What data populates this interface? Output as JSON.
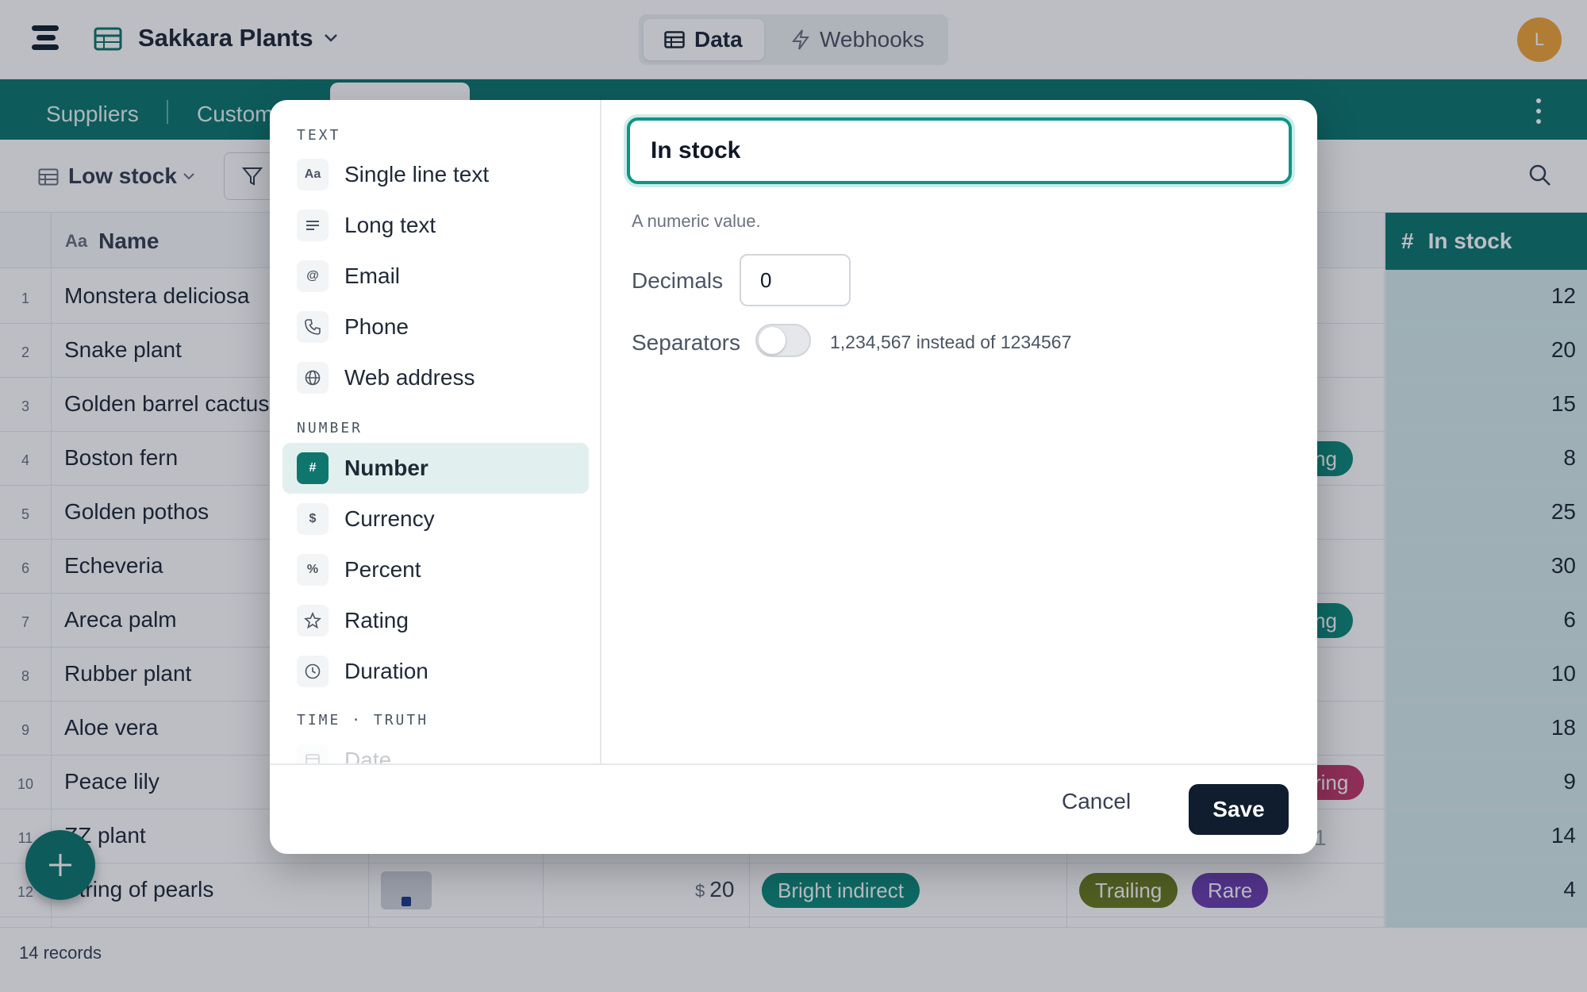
{
  "app": {
    "base_title": "Sakkara Plants",
    "avatar_initial": "L"
  },
  "nav": {
    "data_label": "Data",
    "webhooks_label": "Webhooks"
  },
  "tables": {
    "tab1": "Suppliers",
    "tab2": "Custom"
  },
  "toolbar": {
    "view_name": "Low stock"
  },
  "grid": {
    "name_header": "Name",
    "name_header_icon": "Aa",
    "stock_header": "In stock",
    "stock_header_icon": "#",
    "rows": [
      {
        "num": "1",
        "name": "Monstera deliciosa",
        "stock": "12"
      },
      {
        "num": "2",
        "name": "Snake plant",
        "stock": "20"
      },
      {
        "num": "3",
        "name": "Golden barrel cactus",
        "stock": "15"
      },
      {
        "num": "4",
        "name": "Boston fern",
        "stock": "8"
      },
      {
        "num": "5",
        "name": "Golden pothos",
        "stock": "25"
      },
      {
        "num": "6",
        "name": "Echeveria",
        "stock": "30"
      },
      {
        "num": "7",
        "name": "Areca palm",
        "stock": "6"
      },
      {
        "num": "8",
        "name": "Rubber plant",
        "stock": "10"
      },
      {
        "num": "9",
        "name": "Aloe vera",
        "stock": "18"
      },
      {
        "num": "10",
        "name": "Peace lily",
        "stock": "9"
      },
      {
        "num": "11",
        "name": "ZZ plant",
        "stock": "14"
      },
      {
        "num": "12",
        "name": "String of pearls",
        "stock": "4"
      }
    ],
    "partial_pill_4": "ng",
    "partial_pill_7": "ng",
    "partial_pill_10": "ring",
    "partial_text_11": "1",
    "row12_price_symbol": "$",
    "row12_price": "20",
    "row12_light": "Bright indirect",
    "row12_tag1": "Trailing",
    "row12_tag2": "Rare",
    "records": "14 records"
  },
  "modal": {
    "field_name": "In stock",
    "sections": {
      "text": "TEXT",
      "number": "NUMBER",
      "time": "TIME · TRUTH"
    },
    "types": {
      "single_line": {
        "icon": "Aa",
        "label": "Single line text"
      },
      "long_text": {
        "icon": "lines-icon",
        "label": "Long text"
      },
      "email": {
        "icon": "@",
        "label": "Email"
      },
      "phone": {
        "icon": "phone-icon",
        "label": "Phone"
      },
      "web": {
        "icon": "globe-icon",
        "label": "Web address"
      },
      "number": {
        "icon": "#",
        "label": "Number"
      },
      "currency": {
        "icon": "$",
        "label": "Currency"
      },
      "percent": {
        "icon": "%",
        "label": "Percent"
      },
      "rating": {
        "icon": "star-icon",
        "label": "Rating"
      },
      "duration": {
        "icon": "clock-icon",
        "label": "Duration"
      },
      "date": {
        "icon": "calendar-icon",
        "label": "Date"
      }
    },
    "selected_type": "Number",
    "hint": "A numeric value.",
    "decimals_label": "Decimals",
    "decimals_value": "0",
    "separators_label": "Separators",
    "separators_on": false,
    "separators_example": "1,234,567 instead of 1234567",
    "cancel_label": "Cancel",
    "save_label": "Save"
  },
  "colors": {
    "accent": "#0f766e",
    "dark": "#0f1d2e",
    "avatar": "#f0a53a",
    "tag_teal": "#0f8a7a",
    "tag_olive": "#6b7a1f",
    "tag_purple": "#6d3fb0",
    "tag_pink": "#c0396b"
  }
}
